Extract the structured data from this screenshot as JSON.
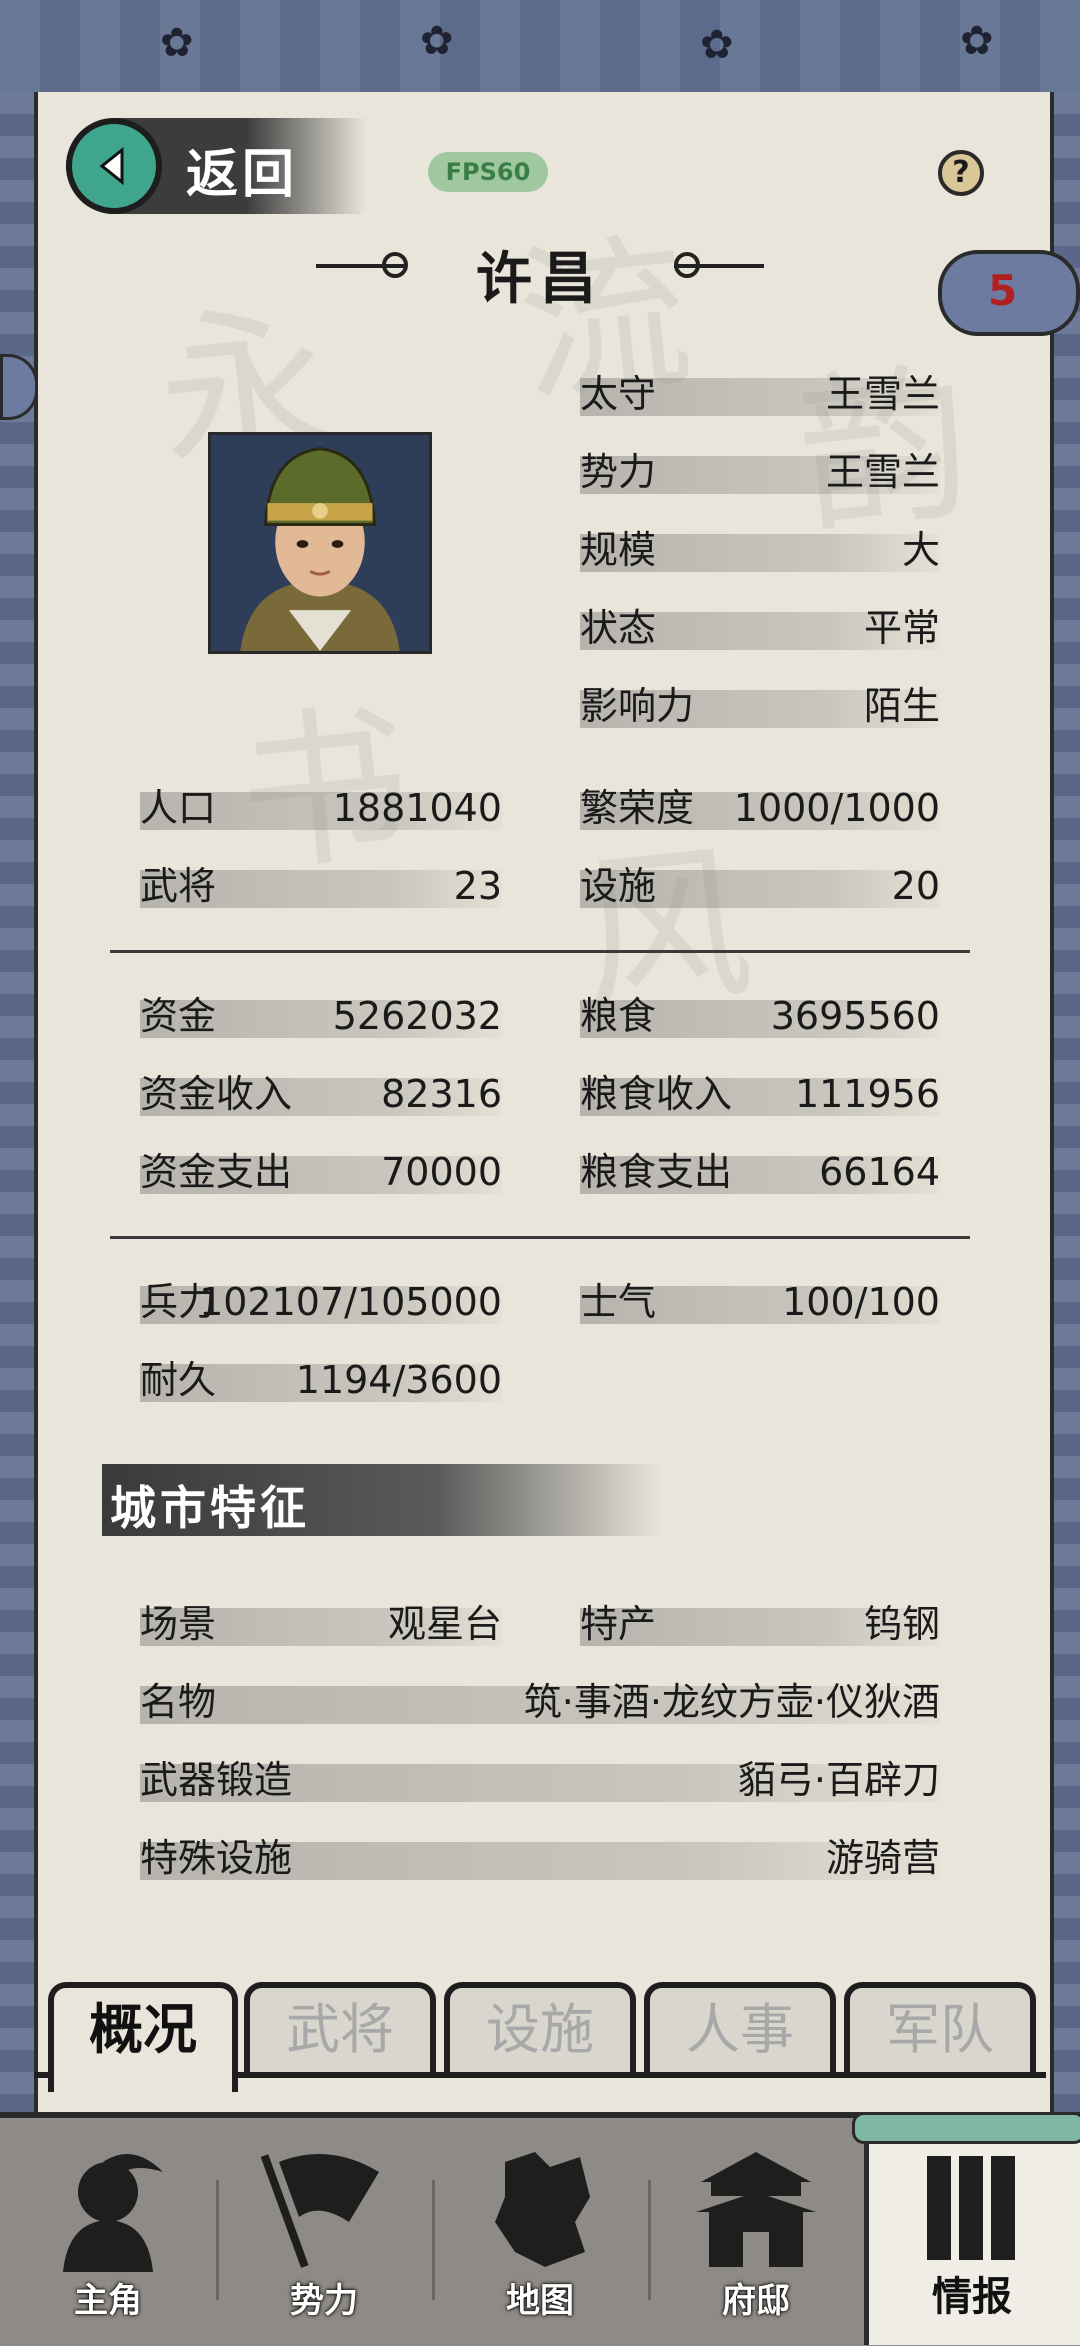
{
  "header": {
    "back_label": "返回",
    "fps_label": "FPS60",
    "help_label": "?",
    "city_title": "许昌",
    "notice_count": "5"
  },
  "governor_info": [
    {
      "label": "太守",
      "value": "王雪兰"
    },
    {
      "label": "势力",
      "value": "王雪兰"
    },
    {
      "label": "规模",
      "value": "大"
    },
    {
      "label": "状态",
      "value": "平常"
    },
    {
      "label": "影响力",
      "value": "陌生"
    }
  ],
  "stats_group1": [
    {
      "label": "人口",
      "value": "1881040"
    },
    {
      "label": "繁荣度",
      "value": "1000/1000"
    },
    {
      "label": "武将",
      "value": "23"
    },
    {
      "label": "设施",
      "value": "20"
    }
  ],
  "stats_group2": [
    {
      "label": "资金",
      "value": "5262032"
    },
    {
      "label": "粮食",
      "value": "3695560"
    },
    {
      "label": "资金收入",
      "value": "82316"
    },
    {
      "label": "粮食收入",
      "value": "111956"
    },
    {
      "label": "资金支出",
      "value": "70000"
    },
    {
      "label": "粮食支出",
      "value": "66164"
    }
  ],
  "stats_group3": [
    {
      "label": "兵力",
      "value": "102107/105000"
    },
    {
      "label": "士气",
      "value": "100/100"
    },
    {
      "label": "耐久",
      "value": "1194/3600"
    }
  ],
  "features": {
    "title": "城市特征",
    "items": [
      {
        "label": "场景",
        "value": "观星台"
      },
      {
        "label": "特产",
        "value": "钨钢"
      },
      {
        "label": "名物",
        "value": "筑·事酒·龙纹方壶·仪狄酒"
      },
      {
        "label": "武器锻造",
        "value": "貊弓·百辟刀"
      },
      {
        "label": "特殊设施",
        "value": "游骑营"
      }
    ]
  },
  "tabs": [
    "概况",
    "武将",
    "设施",
    "人事",
    "军队"
  ],
  "active_tab": "概况",
  "bottom_nav": [
    {
      "label": "主角",
      "icon": "hero-icon"
    },
    {
      "label": "势力",
      "icon": "flag-icon"
    },
    {
      "label": "地图",
      "icon": "map-icon"
    },
    {
      "label": "府邸",
      "icon": "mansion-icon"
    },
    {
      "label": "情报",
      "icon": "scroll-icon"
    }
  ],
  "colors": {
    "paper": "#e9e5da",
    "frame": "#5c6a8c",
    "back_button": "#3fa58c",
    "notice_number": "#b02020"
  }
}
